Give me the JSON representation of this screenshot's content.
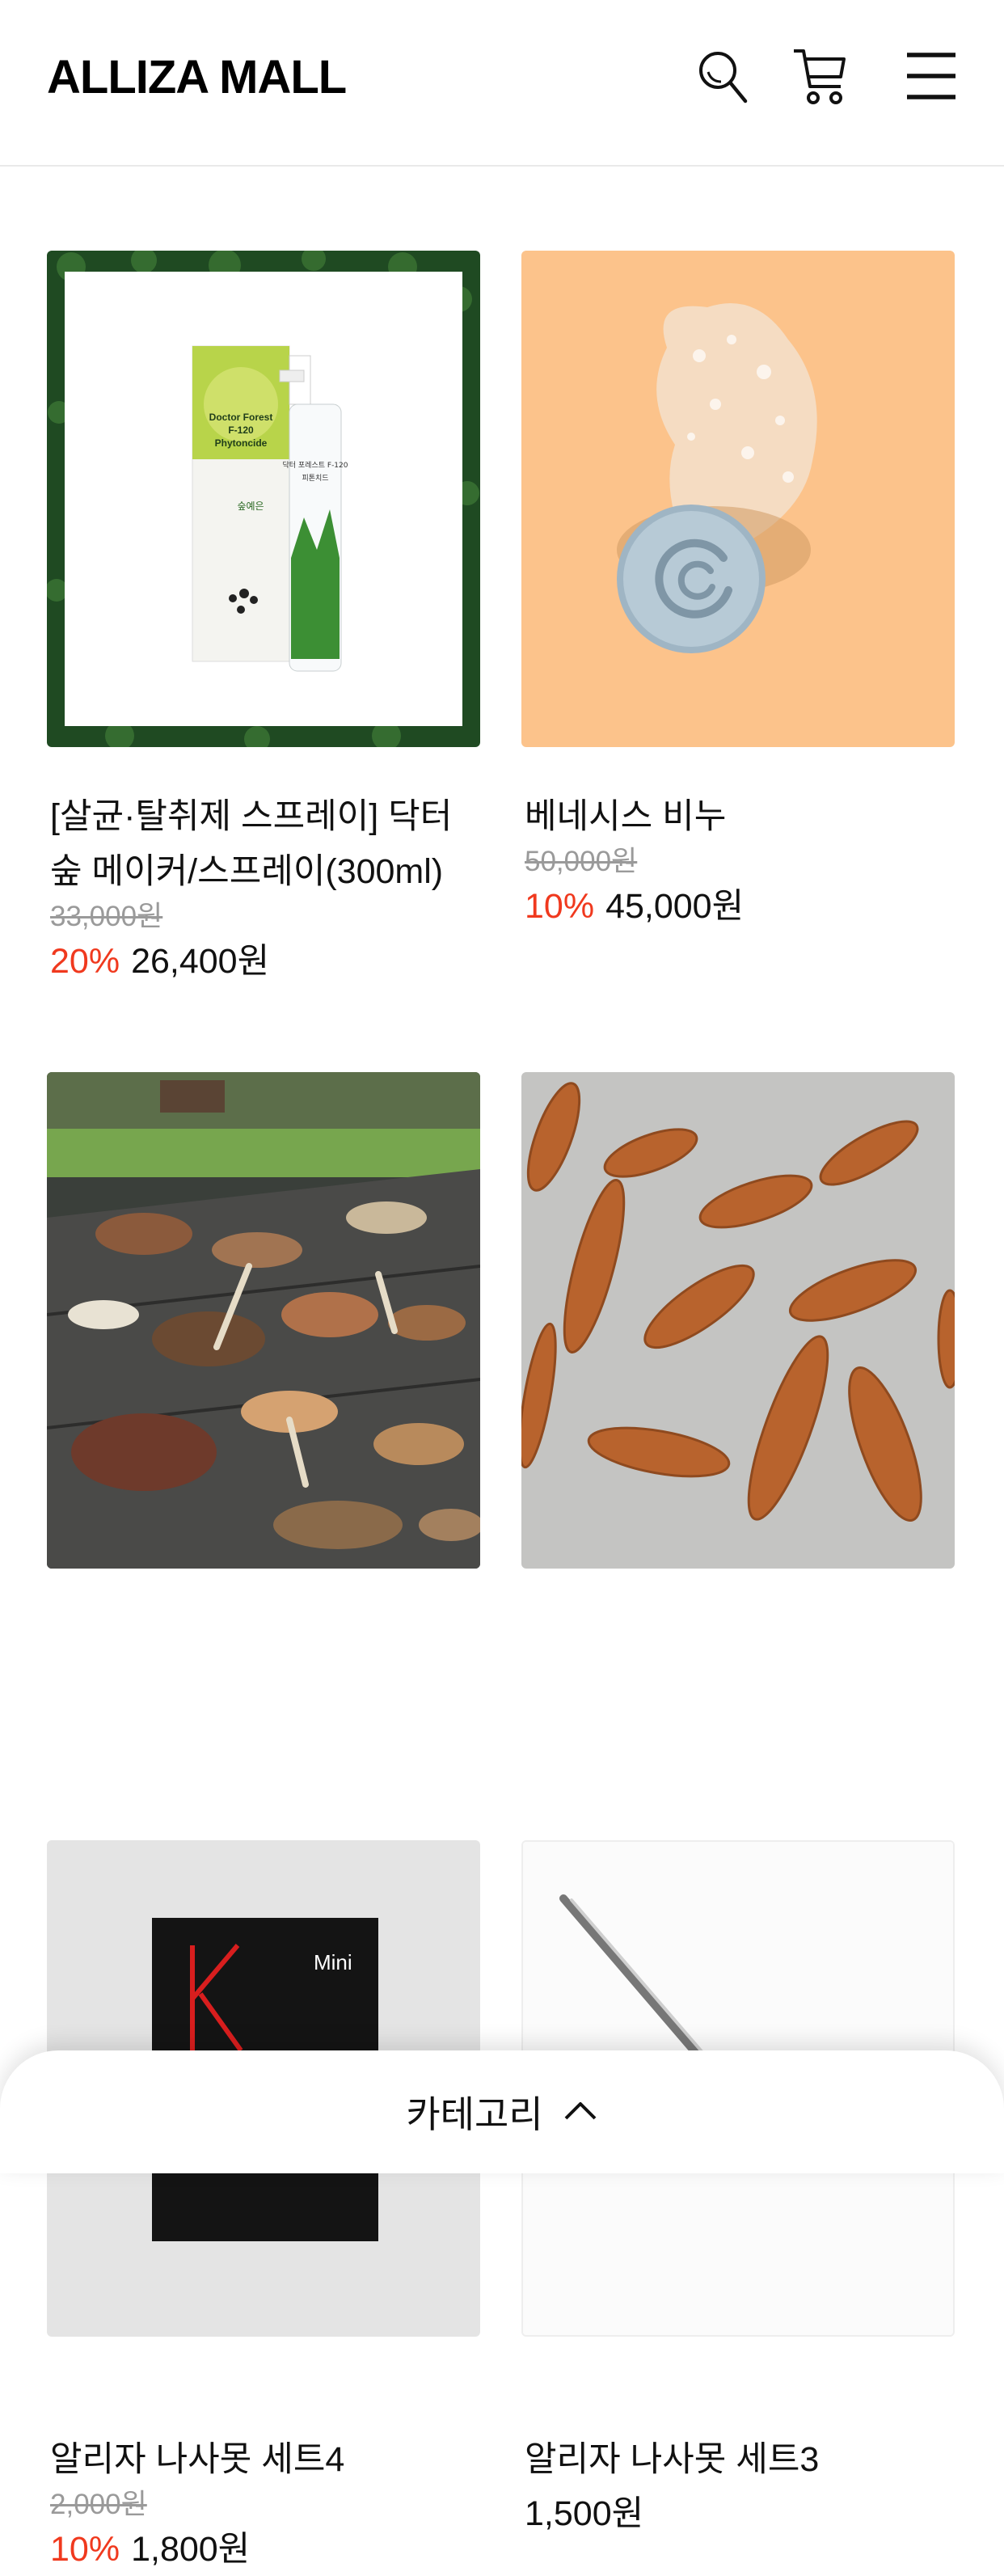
{
  "header": {
    "brand": "ALLIZA MALL",
    "icons": [
      "search-icon",
      "cart-icon",
      "menu-icon"
    ]
  },
  "products": [
    {
      "name": "[살균·탈취제 스프레이] 닥터숲 메이커/스프레이(300ml)",
      "original_price": "33,000원",
      "discount": "20%",
      "price": "26,400원",
      "image_text": [
        "Doctor Forest",
        "F-120",
        "Phytoncide",
        "숲예은",
        "닥터 포레스트 F-120",
        "피톤치드"
      ]
    },
    {
      "name": "베네시스 비누",
      "original_price": "50,000원",
      "discount": "10%",
      "price": "45,000원"
    },
    {
      "name": "알리자 나사못 세트4",
      "original_price": "2,000원",
      "discount": "10%",
      "price": "1,800원"
    },
    {
      "name": "알리자 나사못 세트3",
      "price": "1,500원"
    },
    {
      "image_text": [
        "Mini"
      ]
    },
    {}
  ],
  "bottom_sheet": {
    "label": "카테고리",
    "icon": "chevron-up-icon"
  },
  "colors": {
    "discount": "#f0391e",
    "strikethrough": "#9a9a9a",
    "peach_background": "#fcc38b"
  }
}
